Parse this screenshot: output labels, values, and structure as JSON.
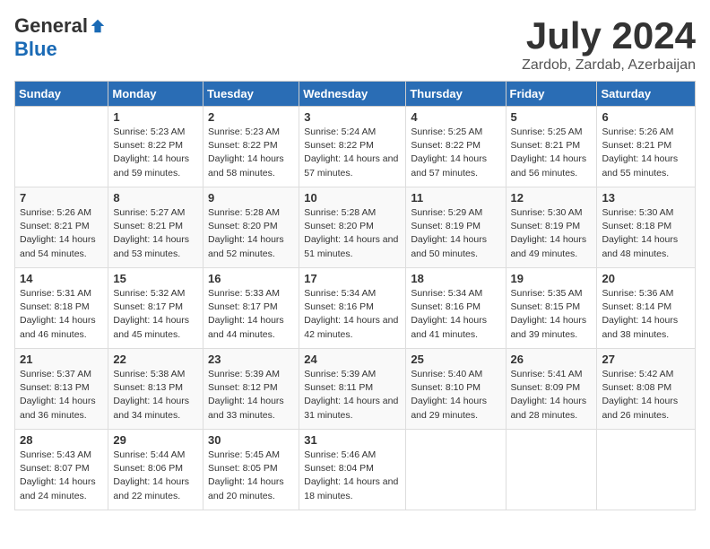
{
  "header": {
    "logo_general": "General",
    "logo_blue": "Blue",
    "title": "July 2024",
    "subtitle": "Zardob, Zardab, Azerbaijan"
  },
  "days_of_week": [
    "Sunday",
    "Monday",
    "Tuesday",
    "Wednesday",
    "Thursday",
    "Friday",
    "Saturday"
  ],
  "weeks": [
    [
      {
        "day": "",
        "sunrise": "",
        "sunset": "",
        "daylight": ""
      },
      {
        "day": "1",
        "sunrise": "Sunrise: 5:23 AM",
        "sunset": "Sunset: 8:22 PM",
        "daylight": "Daylight: 14 hours and 59 minutes."
      },
      {
        "day": "2",
        "sunrise": "Sunrise: 5:23 AM",
        "sunset": "Sunset: 8:22 PM",
        "daylight": "Daylight: 14 hours and 58 minutes."
      },
      {
        "day": "3",
        "sunrise": "Sunrise: 5:24 AM",
        "sunset": "Sunset: 8:22 PM",
        "daylight": "Daylight: 14 hours and 57 minutes."
      },
      {
        "day": "4",
        "sunrise": "Sunrise: 5:25 AM",
        "sunset": "Sunset: 8:22 PM",
        "daylight": "Daylight: 14 hours and 57 minutes."
      },
      {
        "day": "5",
        "sunrise": "Sunrise: 5:25 AM",
        "sunset": "Sunset: 8:21 PM",
        "daylight": "Daylight: 14 hours and 56 minutes."
      },
      {
        "day": "6",
        "sunrise": "Sunrise: 5:26 AM",
        "sunset": "Sunset: 8:21 PM",
        "daylight": "Daylight: 14 hours and 55 minutes."
      }
    ],
    [
      {
        "day": "7",
        "sunrise": "Sunrise: 5:26 AM",
        "sunset": "Sunset: 8:21 PM",
        "daylight": "Daylight: 14 hours and 54 minutes."
      },
      {
        "day": "8",
        "sunrise": "Sunrise: 5:27 AM",
        "sunset": "Sunset: 8:21 PM",
        "daylight": "Daylight: 14 hours and 53 minutes."
      },
      {
        "day": "9",
        "sunrise": "Sunrise: 5:28 AM",
        "sunset": "Sunset: 8:20 PM",
        "daylight": "Daylight: 14 hours and 52 minutes."
      },
      {
        "day": "10",
        "sunrise": "Sunrise: 5:28 AM",
        "sunset": "Sunset: 8:20 PM",
        "daylight": "Daylight: 14 hours and 51 minutes."
      },
      {
        "day": "11",
        "sunrise": "Sunrise: 5:29 AM",
        "sunset": "Sunset: 8:19 PM",
        "daylight": "Daylight: 14 hours and 50 minutes."
      },
      {
        "day": "12",
        "sunrise": "Sunrise: 5:30 AM",
        "sunset": "Sunset: 8:19 PM",
        "daylight": "Daylight: 14 hours and 49 minutes."
      },
      {
        "day": "13",
        "sunrise": "Sunrise: 5:30 AM",
        "sunset": "Sunset: 8:18 PM",
        "daylight": "Daylight: 14 hours and 48 minutes."
      }
    ],
    [
      {
        "day": "14",
        "sunrise": "Sunrise: 5:31 AM",
        "sunset": "Sunset: 8:18 PM",
        "daylight": "Daylight: 14 hours and 46 minutes."
      },
      {
        "day": "15",
        "sunrise": "Sunrise: 5:32 AM",
        "sunset": "Sunset: 8:17 PM",
        "daylight": "Daylight: 14 hours and 45 minutes."
      },
      {
        "day": "16",
        "sunrise": "Sunrise: 5:33 AM",
        "sunset": "Sunset: 8:17 PM",
        "daylight": "Daylight: 14 hours and 44 minutes."
      },
      {
        "day": "17",
        "sunrise": "Sunrise: 5:34 AM",
        "sunset": "Sunset: 8:16 PM",
        "daylight": "Daylight: 14 hours and 42 minutes."
      },
      {
        "day": "18",
        "sunrise": "Sunrise: 5:34 AM",
        "sunset": "Sunset: 8:16 PM",
        "daylight": "Daylight: 14 hours and 41 minutes."
      },
      {
        "day": "19",
        "sunrise": "Sunrise: 5:35 AM",
        "sunset": "Sunset: 8:15 PM",
        "daylight": "Daylight: 14 hours and 39 minutes."
      },
      {
        "day": "20",
        "sunrise": "Sunrise: 5:36 AM",
        "sunset": "Sunset: 8:14 PM",
        "daylight": "Daylight: 14 hours and 38 minutes."
      }
    ],
    [
      {
        "day": "21",
        "sunrise": "Sunrise: 5:37 AM",
        "sunset": "Sunset: 8:13 PM",
        "daylight": "Daylight: 14 hours and 36 minutes."
      },
      {
        "day": "22",
        "sunrise": "Sunrise: 5:38 AM",
        "sunset": "Sunset: 8:13 PM",
        "daylight": "Daylight: 14 hours and 34 minutes."
      },
      {
        "day": "23",
        "sunrise": "Sunrise: 5:39 AM",
        "sunset": "Sunset: 8:12 PM",
        "daylight": "Daylight: 14 hours and 33 minutes."
      },
      {
        "day": "24",
        "sunrise": "Sunrise: 5:39 AM",
        "sunset": "Sunset: 8:11 PM",
        "daylight": "Daylight: 14 hours and 31 minutes."
      },
      {
        "day": "25",
        "sunrise": "Sunrise: 5:40 AM",
        "sunset": "Sunset: 8:10 PM",
        "daylight": "Daylight: 14 hours and 29 minutes."
      },
      {
        "day": "26",
        "sunrise": "Sunrise: 5:41 AM",
        "sunset": "Sunset: 8:09 PM",
        "daylight": "Daylight: 14 hours and 28 minutes."
      },
      {
        "day": "27",
        "sunrise": "Sunrise: 5:42 AM",
        "sunset": "Sunset: 8:08 PM",
        "daylight": "Daylight: 14 hours and 26 minutes."
      }
    ],
    [
      {
        "day": "28",
        "sunrise": "Sunrise: 5:43 AM",
        "sunset": "Sunset: 8:07 PM",
        "daylight": "Daylight: 14 hours and 24 minutes."
      },
      {
        "day": "29",
        "sunrise": "Sunrise: 5:44 AM",
        "sunset": "Sunset: 8:06 PM",
        "daylight": "Daylight: 14 hours and 22 minutes."
      },
      {
        "day": "30",
        "sunrise": "Sunrise: 5:45 AM",
        "sunset": "Sunset: 8:05 PM",
        "daylight": "Daylight: 14 hours and 20 minutes."
      },
      {
        "day": "31",
        "sunrise": "Sunrise: 5:46 AM",
        "sunset": "Sunset: 8:04 PM",
        "daylight": "Daylight: 14 hours and 18 minutes."
      },
      {
        "day": "",
        "sunrise": "",
        "sunset": "",
        "daylight": ""
      },
      {
        "day": "",
        "sunrise": "",
        "sunset": "",
        "daylight": ""
      },
      {
        "day": "",
        "sunrise": "",
        "sunset": "",
        "daylight": ""
      }
    ]
  ]
}
